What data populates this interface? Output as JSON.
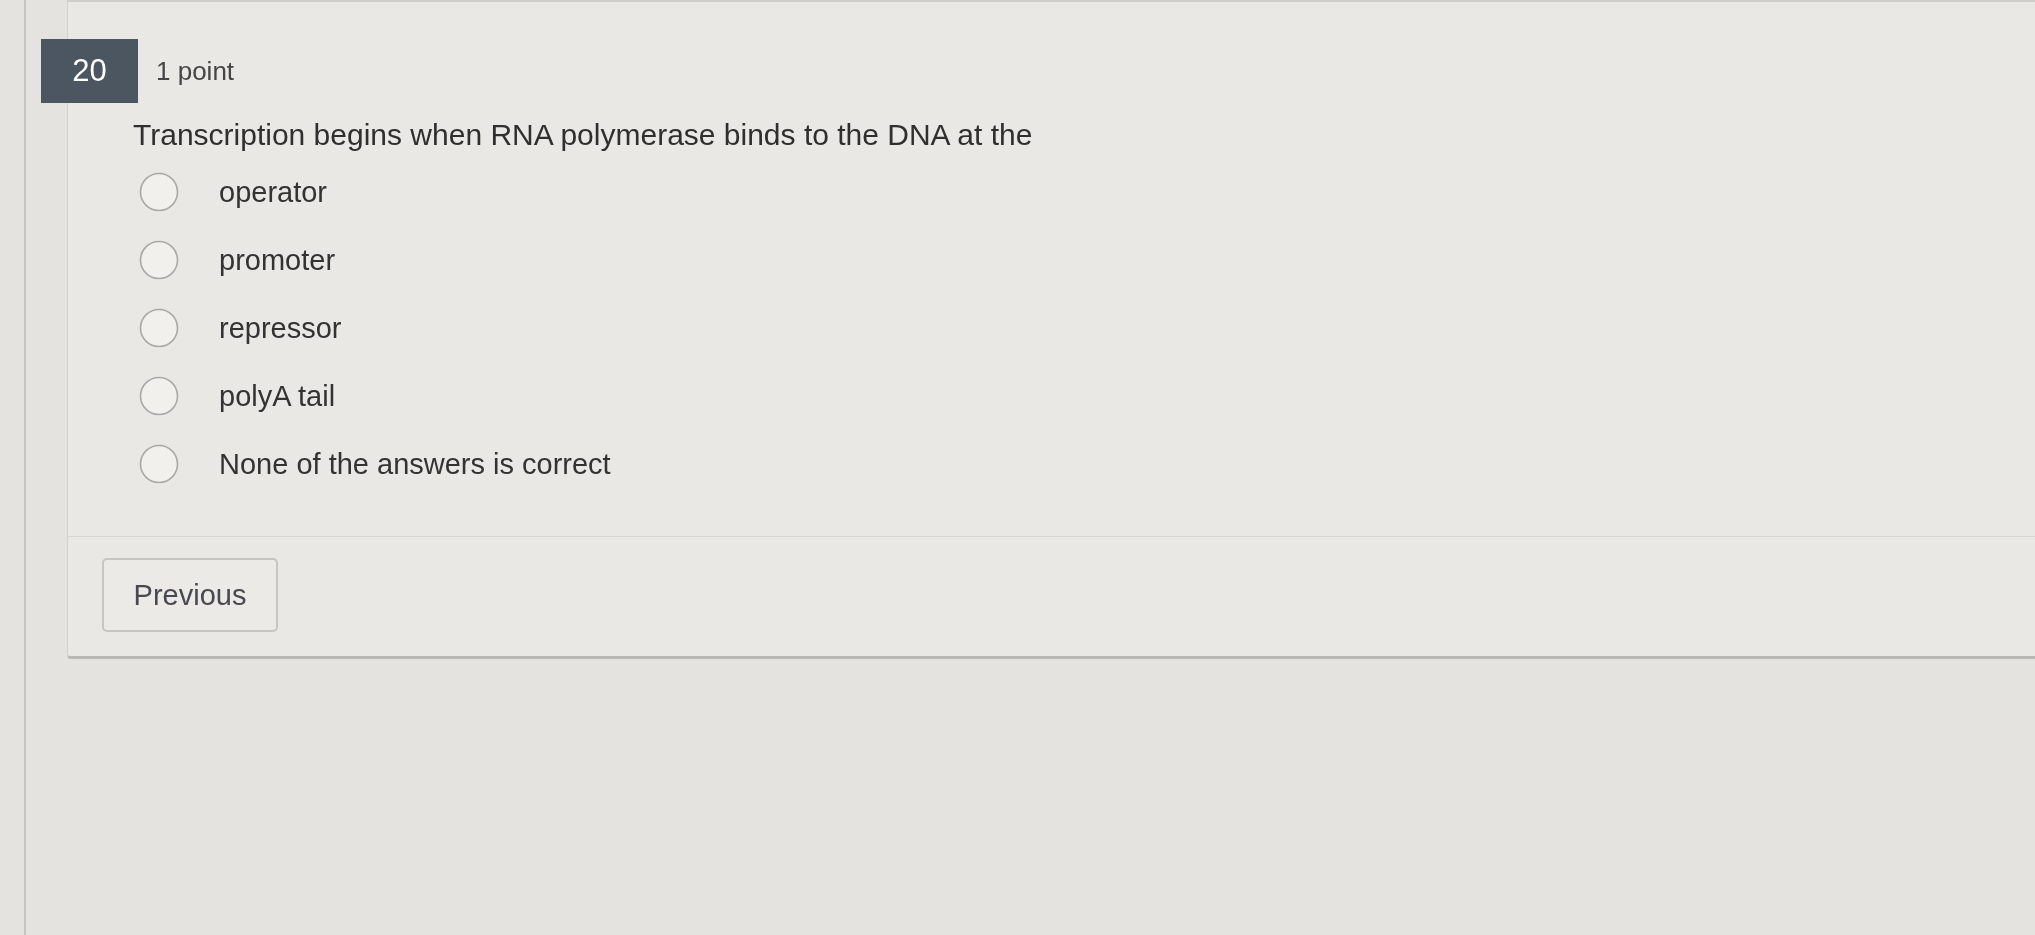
{
  "question": {
    "number": "20",
    "points": "1 point",
    "prompt": "Transcription begins when RNA polymerase binds to the DNA at the",
    "options": [
      {
        "label": "operator",
        "selected": false
      },
      {
        "label": "promoter",
        "selected": false
      },
      {
        "label": "repressor",
        "selected": false
      },
      {
        "label": "polyA tail",
        "selected": false
      },
      {
        "label": "None of the answers is correct",
        "selected": false
      }
    ]
  },
  "navigation": {
    "buttons": [
      "Previous"
    ]
  }
}
